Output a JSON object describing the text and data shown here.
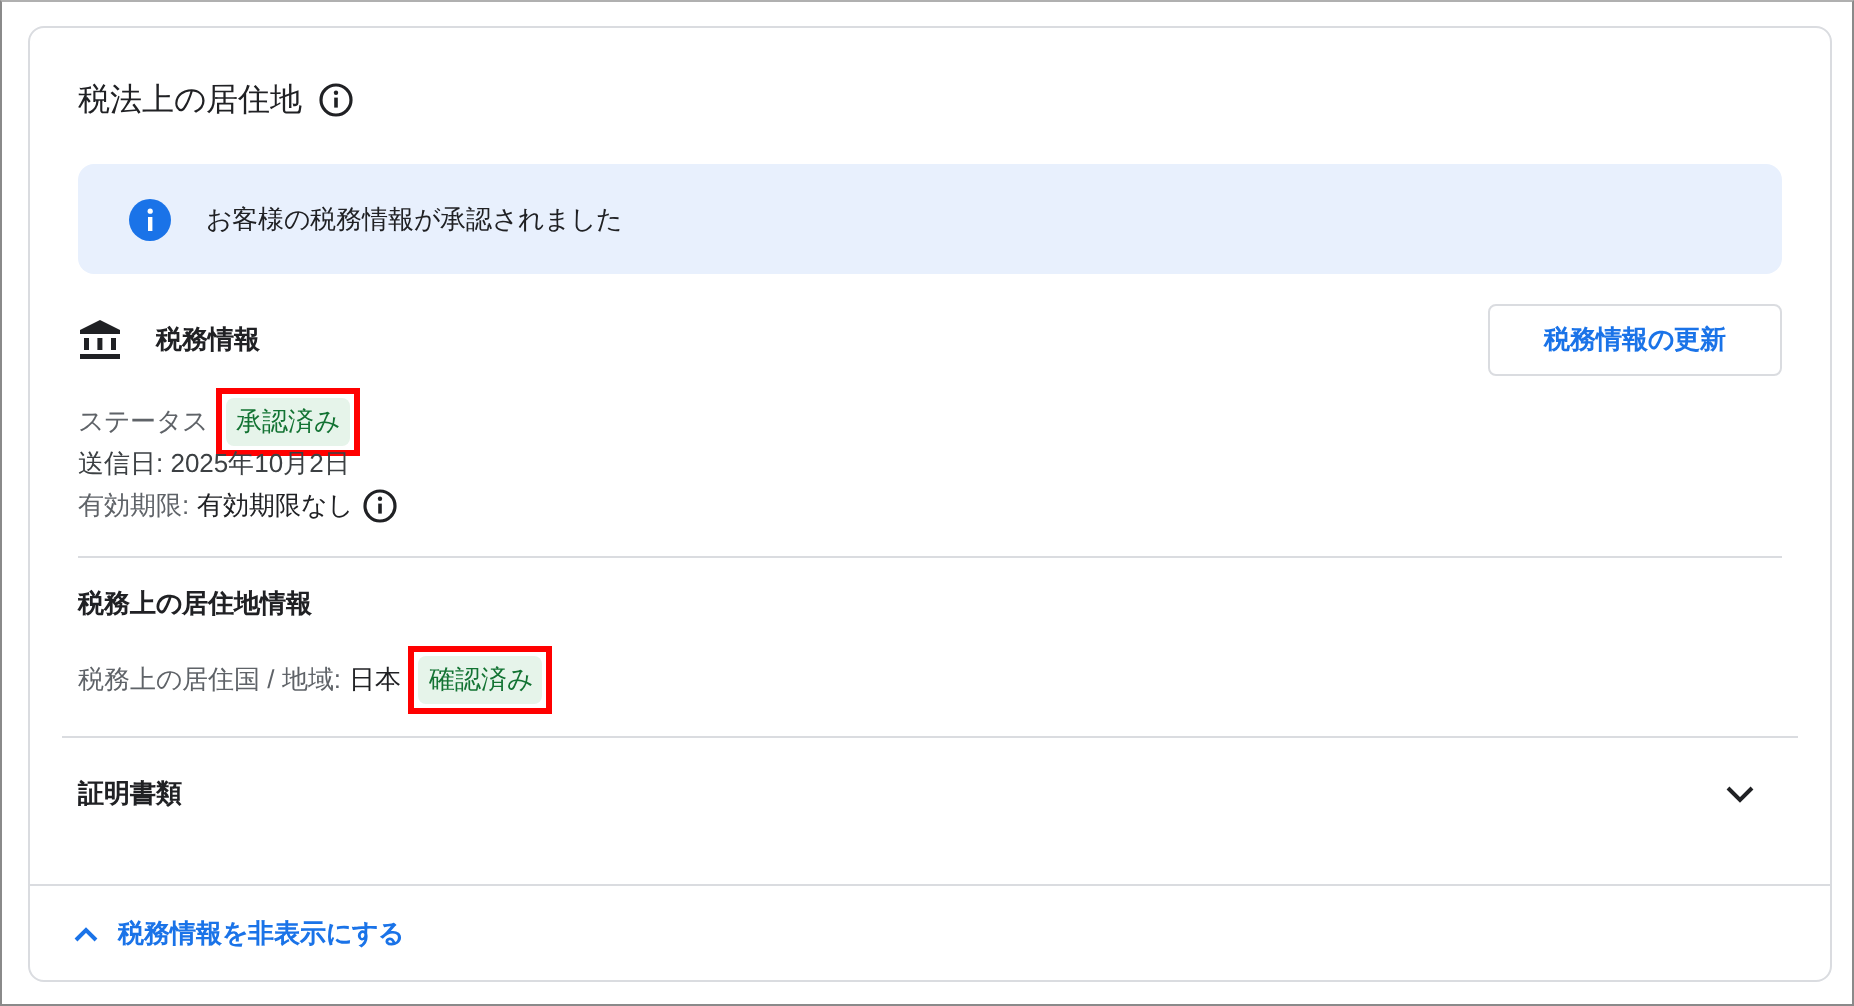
{
  "title": "税法上の居住地",
  "banner": {
    "text": "お客様の税務情報が承認されました"
  },
  "tax_info": {
    "heading": "税務情報",
    "update_button": "税務情報の更新",
    "status_label": "ステータス",
    "status_badge": {
      "text": "承認済み",
      "highlighted": true
    },
    "sent_date": "送信日: 2025年10月2日",
    "expiry_label": "有効期限:",
    "expiry_value": "有効期限なし"
  },
  "residence": {
    "heading": "税務上の居住地情報",
    "label": "税務上の居住国 / 地域:",
    "value": "日本",
    "badge": {
      "text": "確認済み",
      "highlighted": true
    }
  },
  "documents": {
    "label": "証明書類",
    "expanded": false
  },
  "footer_link": {
    "text": "税務情報を非表示にする",
    "expanded": true
  }
}
